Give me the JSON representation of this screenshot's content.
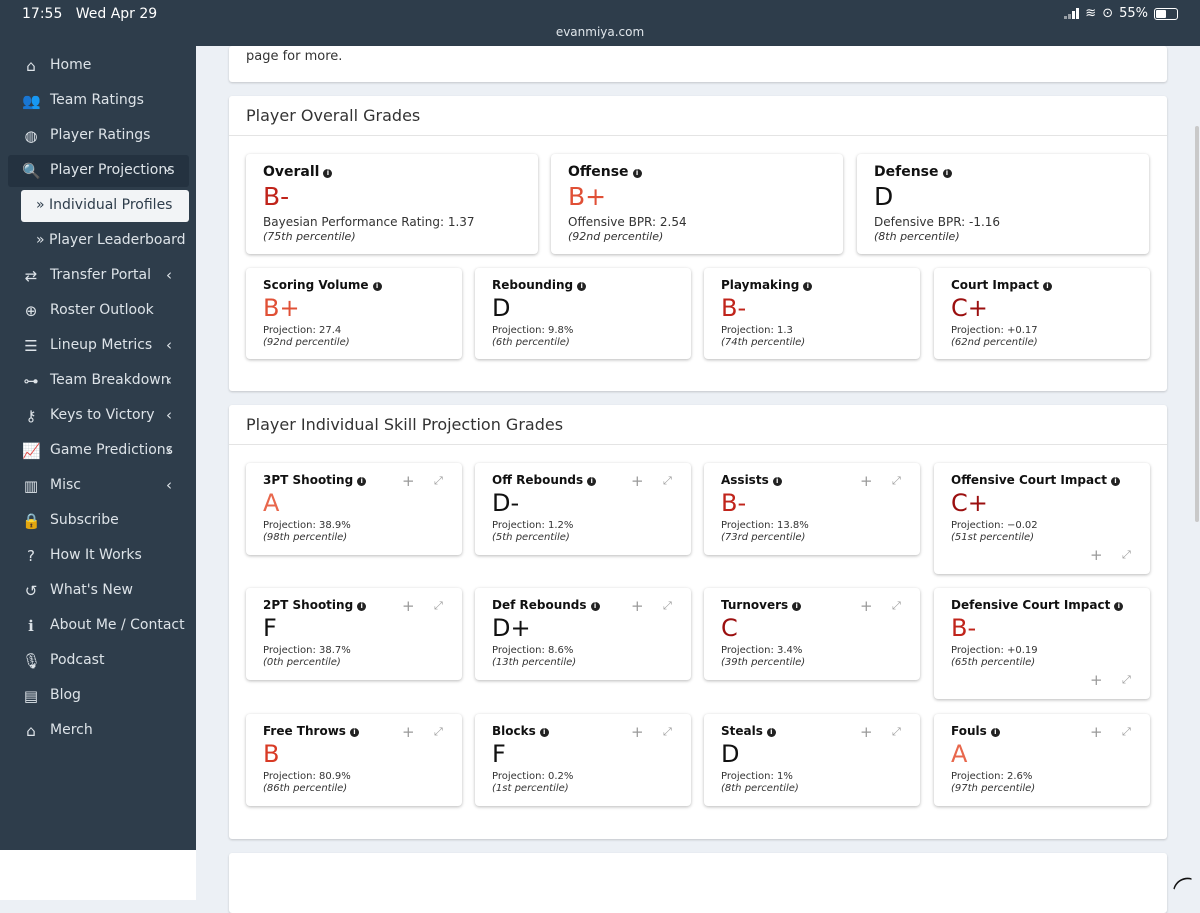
{
  "status": {
    "time": "17:55",
    "date": "Wed Apr 29",
    "url": "evanmiya.com",
    "battery": "55%"
  },
  "sidebar": {
    "items": [
      {
        "label": "Home",
        "icon": "home-icon",
        "glyph": "⌂"
      },
      {
        "label": "Team Ratings",
        "icon": "users-icon",
        "glyph": "👥"
      },
      {
        "label": "Player Ratings",
        "icon": "basketball-icon",
        "glyph": "◍"
      },
      {
        "label": "Player Projections",
        "icon": "search-chart-icon",
        "glyph": "🔍"
      },
      {
        "label": "Transfer Portal",
        "icon": "exchange-icon",
        "glyph": "⇄"
      },
      {
        "label": "Roster Outlook",
        "icon": "crosshairs-icon",
        "glyph": "⊕"
      },
      {
        "label": "Lineup Metrics",
        "icon": "list-icon",
        "glyph": "☰"
      },
      {
        "label": "Team Breakdown",
        "icon": "sitemap-icon",
        "glyph": "⊶"
      },
      {
        "label": "Keys to Victory",
        "icon": "key-icon",
        "glyph": "⚷"
      },
      {
        "label": "Game Predictions",
        "icon": "line-chart-icon",
        "glyph": "📈"
      },
      {
        "label": "Misc",
        "icon": "bar-chart-icon",
        "glyph": "▥"
      },
      {
        "label": "Subscribe",
        "icon": "lock-icon",
        "glyph": "🔒"
      },
      {
        "label": "How It Works",
        "icon": "question-icon",
        "glyph": "?"
      },
      {
        "label": "What's New",
        "icon": "history-icon",
        "glyph": "↺"
      },
      {
        "label": "About Me / Contact",
        "icon": "info-icon",
        "glyph": "ℹ"
      },
      {
        "label": "Podcast",
        "icon": "microphone-icon",
        "glyph": "🎙"
      },
      {
        "label": "Blog",
        "icon": "blog-icon",
        "glyph": "▤"
      },
      {
        "label": "Merch",
        "icon": "store-icon",
        "glyph": "⌂"
      }
    ],
    "sub_items": [
      "Individual Profiles",
      "Player Leaderboard"
    ]
  },
  "intro": {
    "text": "page for more."
  },
  "overall_box": {
    "title": "Player Overall Grades",
    "big_cards": [
      {
        "title": "Overall",
        "grade": "B-",
        "color": "#c0241b",
        "proj": "Bayesian Performance Rating: 1.37",
        "pct": "(75th percentile)"
      },
      {
        "title": "Offense",
        "grade": "B+",
        "color": "#e05036",
        "proj": "Offensive BPR: 2.54",
        "pct": "(92nd percentile)"
      },
      {
        "title": "Defense",
        "grade": "D",
        "color": "#111111",
        "proj": "Defensive BPR: -1.16",
        "pct": "(8th percentile)"
      }
    ],
    "cards": [
      {
        "title": "Scoring Volume",
        "grade": "B+",
        "color": "#e05036",
        "proj": "Projection: 27.4",
        "pct": "(92nd percentile)"
      },
      {
        "title": "Rebounding",
        "grade": "D",
        "color": "#111111",
        "proj": "Projection: 9.8%",
        "pct": "(6th percentile)"
      },
      {
        "title": "Playmaking",
        "grade": "B-",
        "color": "#c0241b",
        "proj": "Projection: 1.3",
        "pct": "(74th percentile)"
      },
      {
        "title": "Court Impact",
        "grade": "C+",
        "color": "#9b0f0f",
        "proj": "Projection: +0.17",
        "pct": "(62nd percentile)"
      }
    ]
  },
  "skill_box": {
    "title": "Player Individual Skill Projection Grades",
    "cards": [
      {
        "title": "3PT Shooting",
        "grade": "A",
        "color": "#e8674c",
        "proj": "Projection: 38.9%",
        "pct": "(98th percentile)"
      },
      {
        "title": "Off Rebounds",
        "grade": "D-",
        "color": "#111111",
        "proj": "Projection: 1.2%",
        "pct": "(5th percentile)"
      },
      {
        "title": "Assists",
        "grade": "B-",
        "color": "#c0241b",
        "proj": "Projection: 13.8%",
        "pct": "(73rd percentile)"
      },
      {
        "title": "Offensive Court Impact",
        "grade": "C+",
        "color": "#9b0f0f",
        "proj": "Projection: −0.02",
        "pct": "(51st percentile)"
      },
      {
        "title": "2PT Shooting",
        "grade": "F",
        "color": "#111111",
        "proj": "Projection: 38.7%",
        "pct": "(0th percentile)"
      },
      {
        "title": "Def Rebounds",
        "grade": "D+",
        "color": "#111111",
        "proj": "Projection: 8.6%",
        "pct": "(13th percentile)"
      },
      {
        "title": "Turnovers",
        "grade": "C",
        "color": "#9b0f0f",
        "proj": "Projection: 3.4%",
        "pct": "(39th percentile)"
      },
      {
        "title": "Defensive Court Impact",
        "grade": "B-",
        "color": "#c0241b",
        "proj": "Projection: +0.19",
        "pct": "(65th percentile)"
      },
      {
        "title": "Free Throws",
        "grade": "B",
        "color": "#d83a25",
        "proj": "Projection: 80.9%",
        "pct": "(86th percentile)"
      },
      {
        "title": "Blocks",
        "grade": "F",
        "color": "#111111",
        "proj": "Projection: 0.2%",
        "pct": "(1st percentile)"
      },
      {
        "title": "Steals",
        "grade": "D",
        "color": "#111111",
        "proj": "Projection: 1%",
        "pct": "(8th percentile)"
      },
      {
        "title": "Fouls",
        "grade": "A",
        "color": "#e8674c",
        "proj": "Projection: 2.6%",
        "pct": "(97th percentile)"
      }
    ]
  }
}
